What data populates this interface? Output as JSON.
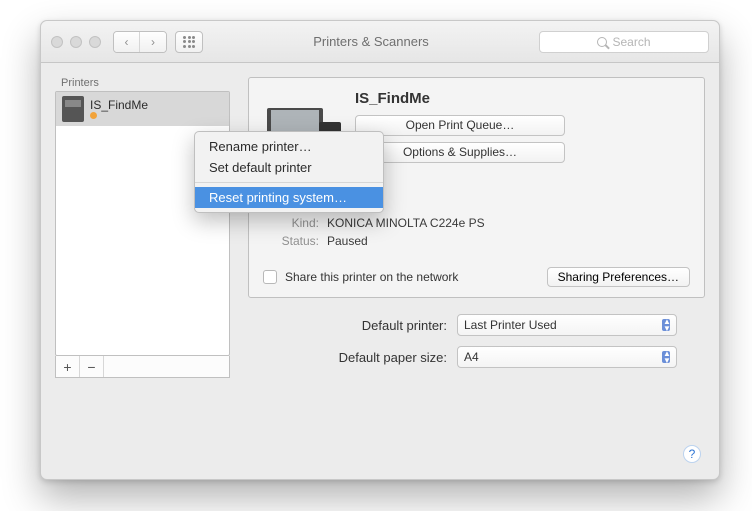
{
  "window": {
    "title": "Printers & Scanners"
  },
  "search": {
    "placeholder": "Search"
  },
  "sidebar": {
    "label": "Printers",
    "items": [
      {
        "name": "IS_FindMe",
        "status": ""
      }
    ]
  },
  "context_menu": {
    "rename": "Rename printer…",
    "set_default": "Set default printer",
    "reset": "Reset printing system…"
  },
  "detail": {
    "name": "IS_FindMe",
    "open_queue": "Open Print Queue…",
    "options_supplies": "Options & Supplies…",
    "meta": {
      "location_k": "Location:",
      "location_v": "",
      "kind_k": "Kind:",
      "kind_v": "KONICA MINOLTA C224e PS",
      "status_k": "Status:",
      "status_v": "Paused"
    },
    "share_label": "Share this printer on the network",
    "sharing_prefs": "Sharing Preferences…"
  },
  "bottom": {
    "default_printer_label": "Default printer:",
    "default_printer_value": "Last Printer Used",
    "paper_label": "Default paper size:",
    "paper_value": "A4"
  },
  "help": "?"
}
